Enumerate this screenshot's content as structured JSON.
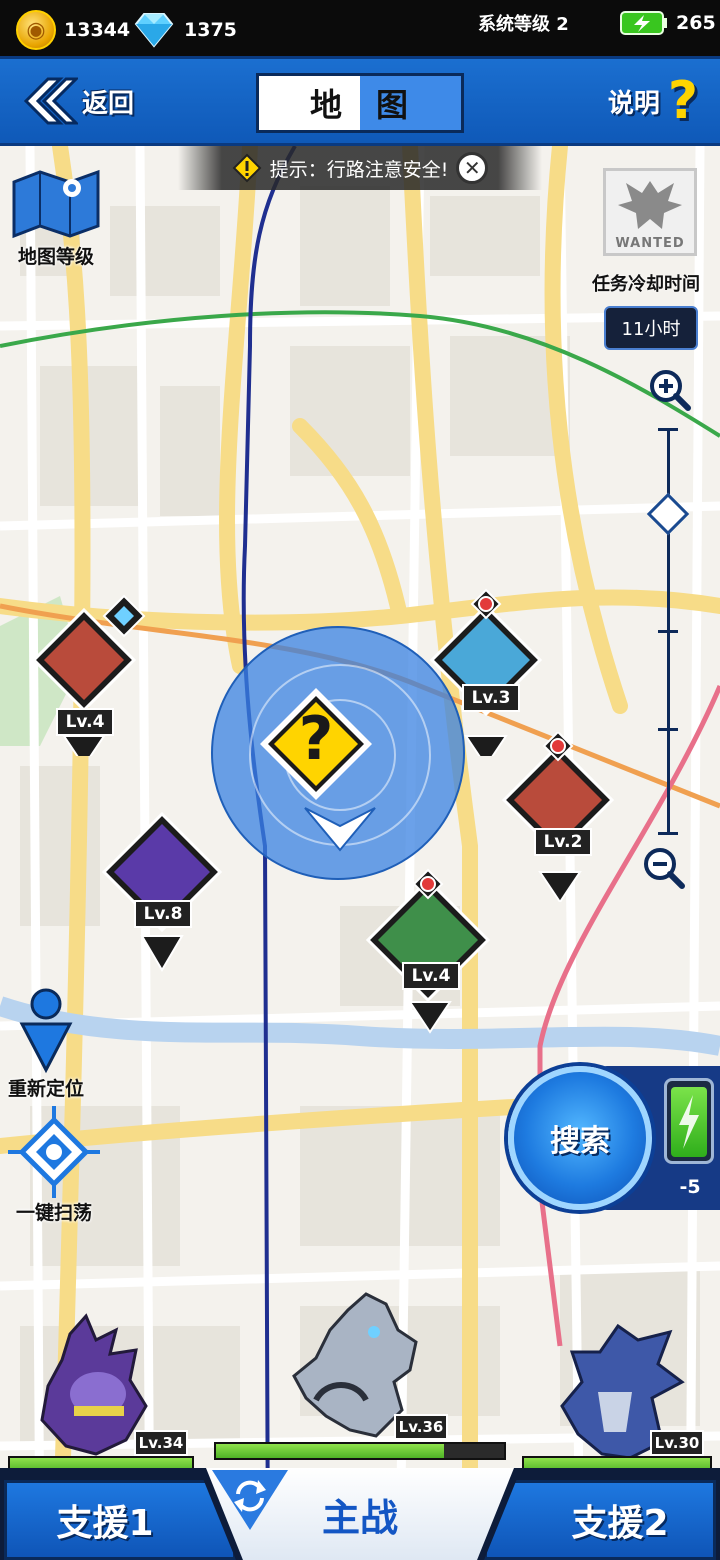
{
  "status": {
    "coins": "13344",
    "gems": "1375",
    "system_level": "系统等级 2",
    "energy": "265"
  },
  "header": {
    "back_label": "返回",
    "title_left": "地",
    "title_right": "图",
    "help_label": "说明",
    "help_icon": "?"
  },
  "map": {
    "tip_text": "提示：行路注意安全!",
    "map_level_label": "地图等级",
    "wanted_text": "WANTED",
    "cooldown_label": "任务冷却时间",
    "cooldown_value": "11小时",
    "relocate_label": "重新定位",
    "sweep_label": "一键扫荡",
    "quest_symbol": "?",
    "search_label": "搜索",
    "search_cost": "-5",
    "monsters": [
      {
        "level": "Lv.4",
        "color": "#b94b3b",
        "badge": "gem"
      },
      {
        "level": "Lv.3",
        "color": "#4aa8d8",
        "badge": "pokeball"
      },
      {
        "level": "Lv.2",
        "color": "#b94b3b",
        "badge": "pokeball"
      },
      {
        "level": "Lv.8",
        "color": "#5a3aa8",
        "badge": "none"
      },
      {
        "level": "Lv.4",
        "color": "#3f8f4a",
        "badge": "pokeball"
      }
    ]
  },
  "team": {
    "support1_level": "Lv.34",
    "main_level": "Lv.36",
    "support2_level": "Lv.30",
    "support1_hp": 1.0,
    "main_hp": 0.79,
    "support2_hp": 1.0
  },
  "nav": {
    "support1_label": "支援1",
    "main_label": "主战",
    "support2_label": "支援2"
  },
  "colors": {
    "primary_blue": "#1b6fd0",
    "accent_yellow": "#ffd400",
    "hp_green": "#4fb326"
  }
}
